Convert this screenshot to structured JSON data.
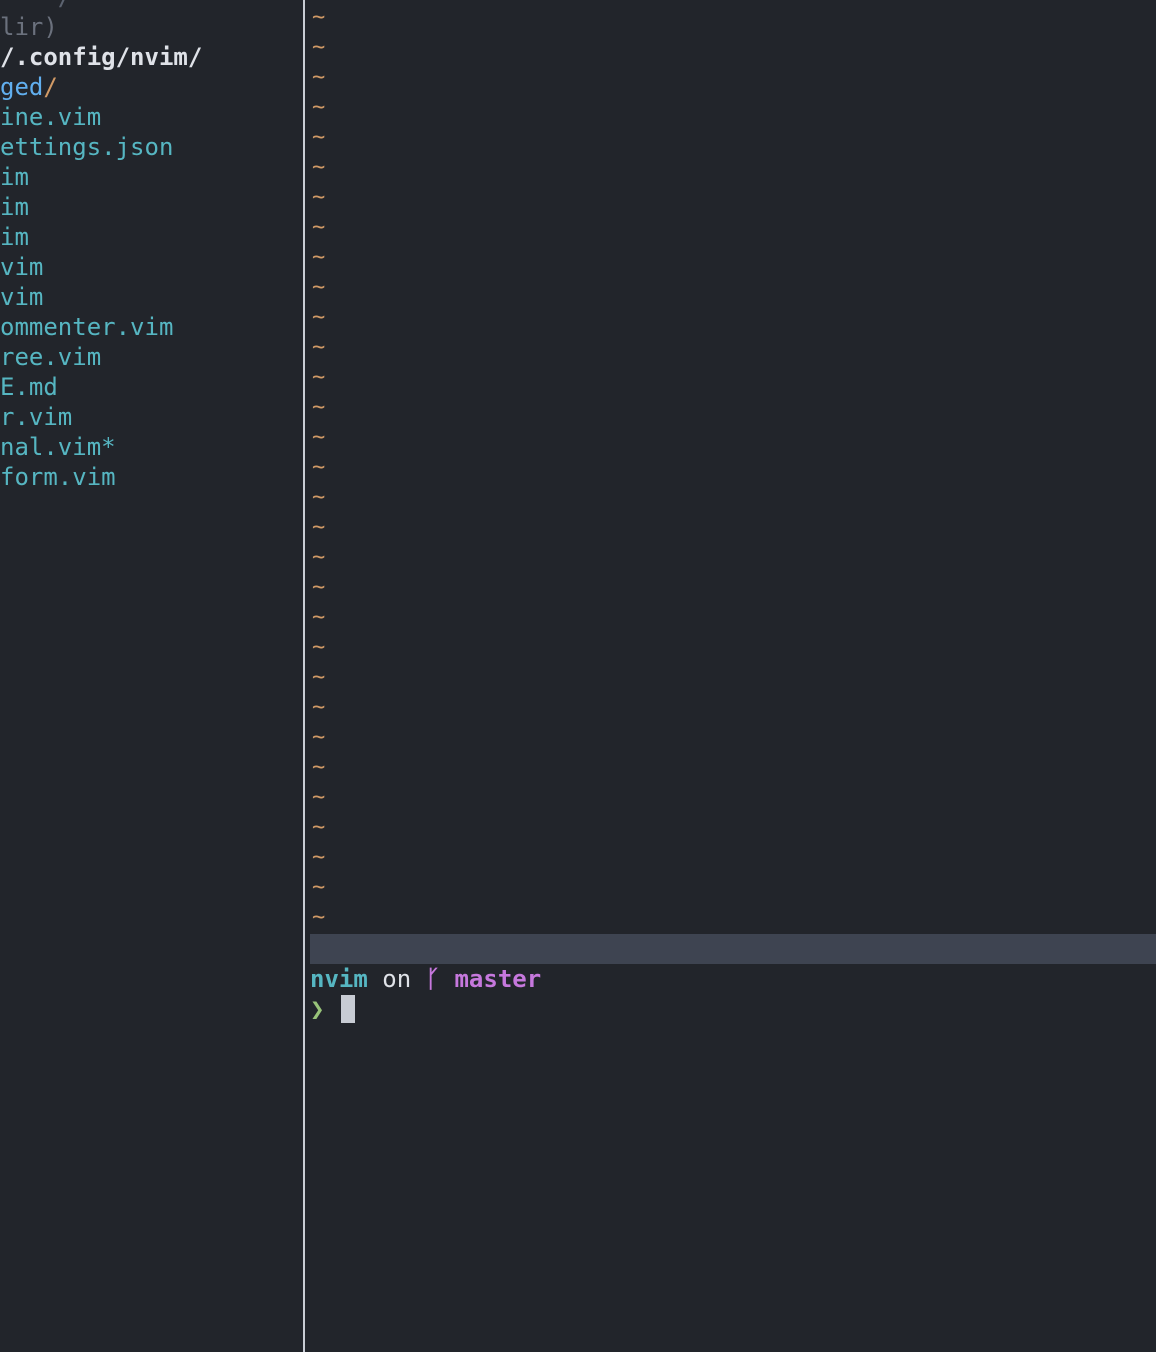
{
  "colors": {
    "background": "#22252b",
    "root_text": "#dfe2e8",
    "directory": "#61afef",
    "dir_slash": "#d19a66",
    "file": "#56b6c2",
    "tilde": "#d19a66",
    "statusline": "#3e4451",
    "branch": "#c678dd",
    "prompt": "#98c379"
  },
  "tree": {
    "top_partial": "    /",
    "hint": "lir)",
    "root": "/.config/nvim/",
    "dir": {
      "name": "ged",
      "slash": "/"
    },
    "files": [
      "ine.vim",
      "ettings.json",
      "im",
      "im",
      "im",
      "vim",
      "vim",
      "ommenter.vim",
      "ree.vim",
      "E.md",
      "r.vim",
      "nal.vim*",
      "form.vim"
    ]
  },
  "editor": {
    "tilde_char": "~",
    "tilde_count": 31
  },
  "terminal": {
    "dir": "nvim",
    "on": "on",
    "branch_icon": "ᚴ",
    "branch": "master",
    "prompt": "❯"
  }
}
